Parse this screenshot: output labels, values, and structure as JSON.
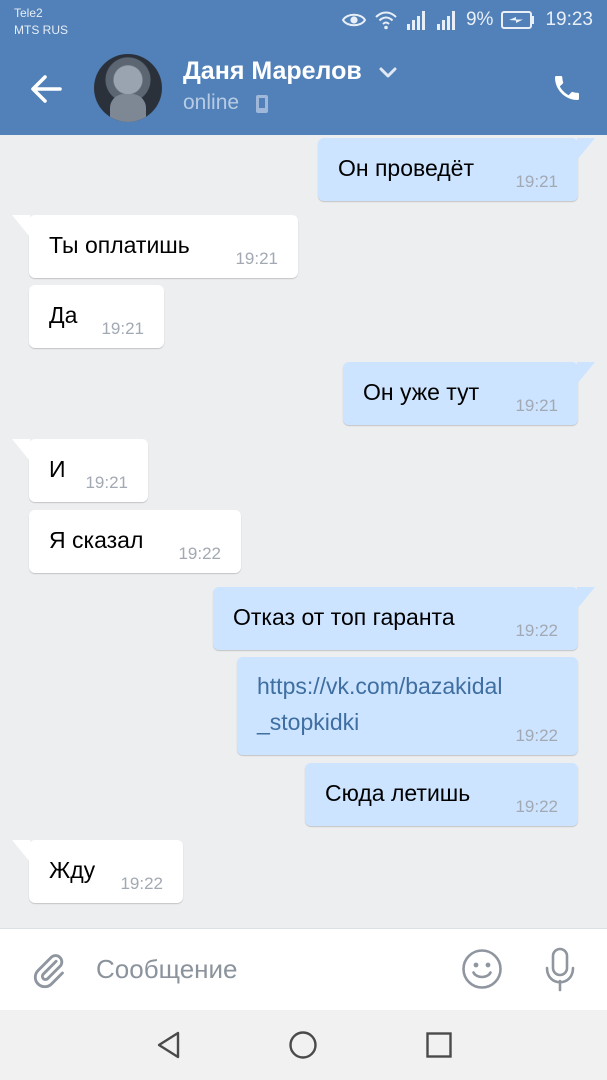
{
  "status_bar": {
    "carrier_1": "Tele2",
    "carrier_2": "MTS RUS",
    "battery_percent": "9%",
    "time": "19:23",
    "icons": [
      "eye-icon",
      "wifi-icon",
      "signal-icon",
      "signal-icon",
      "battery-charging-icon"
    ]
  },
  "toolbar": {
    "contact_name": "Даня Марелов",
    "presence": "online",
    "icons": [
      "back-arrow-icon",
      "chevron-down-icon",
      "mobile-icon",
      "phone-icon"
    ]
  },
  "messages": [
    {
      "direction": "out",
      "text": "Он проведёт",
      "time": "19:21"
    },
    {
      "direction": "in",
      "text": "Ты оплатишь",
      "time": "19:21"
    },
    {
      "direction": "in",
      "text": "Да",
      "time": "19:21"
    },
    {
      "direction": "out",
      "text": "Он уже тут",
      "time": "19:21"
    },
    {
      "direction": "in",
      "text": "И",
      "time": "19:21"
    },
    {
      "direction": "in",
      "text": "Я сказал",
      "time": "19:22"
    },
    {
      "direction": "out",
      "text": "Отказ от топ гаранта",
      "time": "19:22"
    },
    {
      "direction": "out",
      "link_line_1": "https://vk.com/bazakidal",
      "link_line_2": "_stopkidki",
      "time": "19:22"
    },
    {
      "direction": "out",
      "text": "Сюда летишь",
      "time": "19:22"
    },
    {
      "direction": "in",
      "text": "Жду",
      "time": "19:22"
    }
  ],
  "composer": {
    "placeholder": "Сообщение",
    "value": "",
    "icons": [
      "paperclip-icon",
      "emoji-icon",
      "microphone-icon"
    ]
  },
  "navigation": {
    "icons": [
      "back-triangle-icon",
      "home-circle-icon",
      "recents-square-icon"
    ]
  },
  "colors": {
    "header": "#5181b8",
    "outgoing_bubble": "#cce4ff",
    "incoming_bubble": "#ffffff",
    "background": "#edeef0",
    "link": "#3f6ea1"
  }
}
